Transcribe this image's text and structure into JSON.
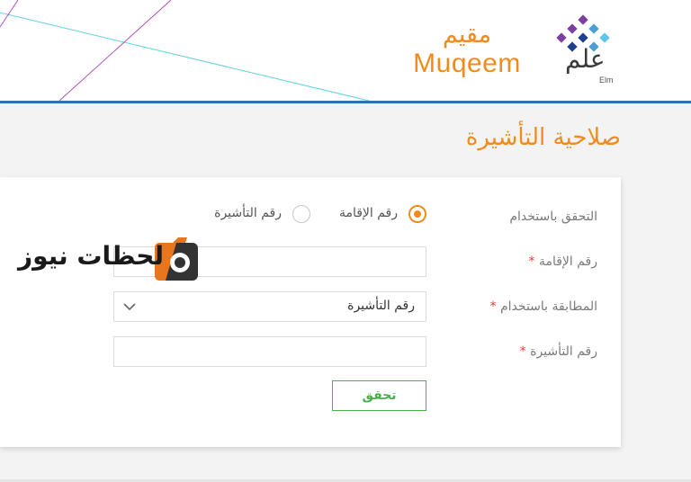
{
  "header": {
    "muqeem_logo_ar": "مقيم",
    "muqeem_logo_en": "Muqeem",
    "elm_logo_ar": "علم",
    "elm_logo_en": "Elm"
  },
  "page": {
    "title": "صلاحية التأشيرة"
  },
  "form": {
    "verify_by_label": "التحقق باستخدام",
    "radio_options": [
      {
        "label": "رقم الإقامة",
        "selected": true
      },
      {
        "label": "رقم التأشيرة",
        "selected": false
      }
    ],
    "iqama_label": "رقم الإقامة",
    "iqama_value": "",
    "match_by_label": "المطابقة باستخدام",
    "match_by_selected": "رقم التأشيرة",
    "visa_label": "رقم التأشيرة",
    "visa_value": "",
    "required_marker": "*",
    "verify_button": "تحقق"
  },
  "watermark": {
    "text": "لحظات نيوز"
  },
  "colors": {
    "accent_orange": "#f08c1e",
    "header_border_blue": "#2d6fb3",
    "button_green": "#4cae4c",
    "required_red": "#e23b3b"
  }
}
